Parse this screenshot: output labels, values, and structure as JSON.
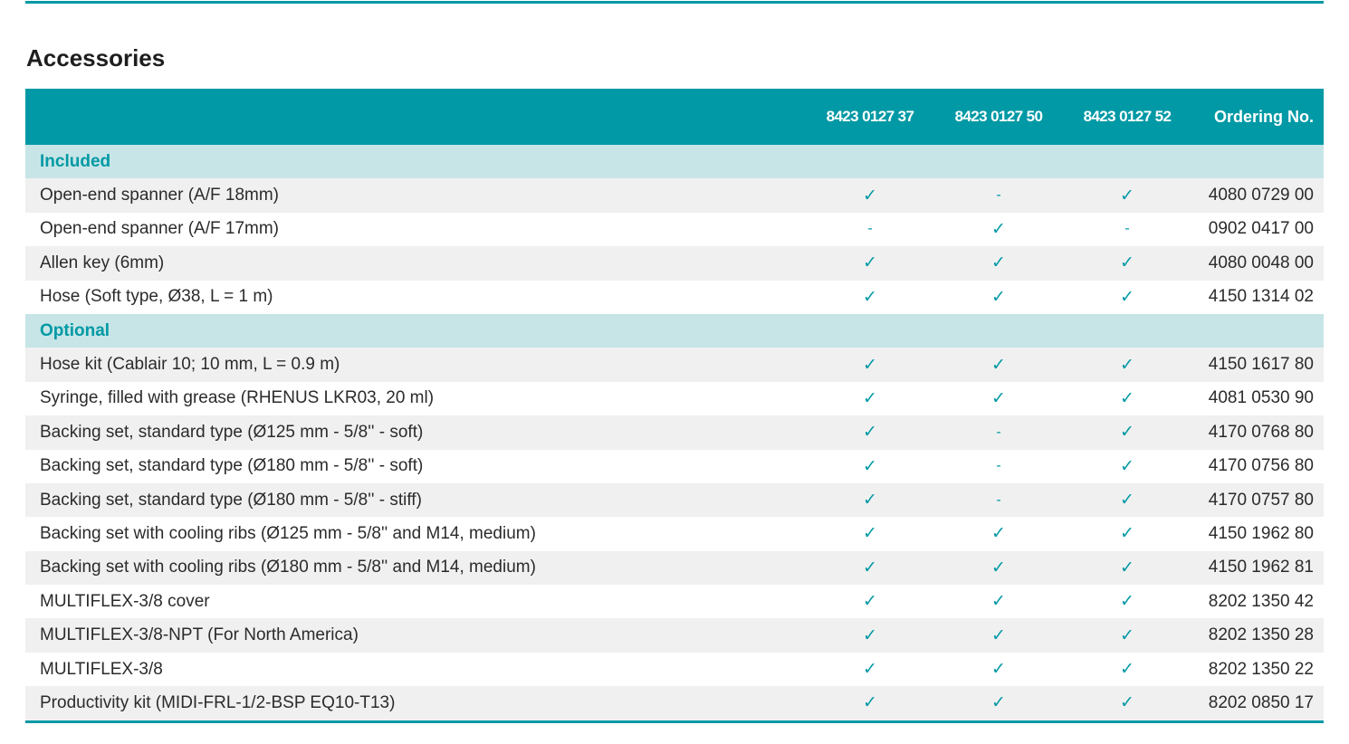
{
  "title": "Accessories",
  "colors": {
    "accent": "#0099a5",
    "group_bg": "#c7e5e6",
    "alt_row": "#f0f0f0"
  },
  "table": {
    "headers": [
      "",
      "8423 0127 37",
      "8423 0127 50",
      "8423 0127 52",
      "Ordering No."
    ],
    "groups": [
      {
        "label": "Included",
        "rows": [
          {
            "desc": "Open-end spanner (A/F 18mm)",
            "marks": [
              "✓",
              "-",
              "✓"
            ],
            "order": "4080 0729 00"
          },
          {
            "desc": "Open-end spanner (A/F 17mm)",
            "marks": [
              "-",
              "✓",
              "-"
            ],
            "order": "0902 0417 00"
          },
          {
            "desc": "Allen key (6mm)",
            "marks": [
              "✓",
              "✓",
              "✓"
            ],
            "order": "4080 0048 00"
          },
          {
            "desc": "Hose (Soft type, Ø38, L = 1 m)",
            "marks": [
              "✓",
              "✓",
              "✓"
            ],
            "order": "4150 1314 02"
          }
        ]
      },
      {
        "label": "Optional",
        "rows": [
          {
            "desc": "Hose kit (Cablair 10; 10 mm, L = 0.9 m)",
            "marks": [
              "✓",
              "✓",
              "✓"
            ],
            "order": "4150 1617 80"
          },
          {
            "desc": "Syringe, filled with grease (RHENUS LKR03, 20 ml)",
            "marks": [
              "✓",
              "✓",
              "✓"
            ],
            "order": "4081 0530 90"
          },
          {
            "desc": "Backing set, standard type (Ø125 mm - 5/8'' - soft)",
            "marks": [
              "✓",
              "-",
              "✓"
            ],
            "order": "4170 0768 80"
          },
          {
            "desc": "Backing set, standard type (Ø180 mm - 5/8'' - soft)",
            "marks": [
              "✓",
              "-",
              "✓"
            ],
            "order": "4170 0756 80"
          },
          {
            "desc": "Backing set, standard type (Ø180 mm - 5/8'' - stiff)",
            "marks": [
              "✓",
              "-",
              "✓"
            ],
            "order": "4170 0757 80"
          },
          {
            "desc": "Backing set with cooling ribs (Ø125 mm - 5/8'' and M14, medium)",
            "marks": [
              "✓",
              "✓",
              "✓"
            ],
            "order": "4150 1962 80"
          },
          {
            "desc": "Backing set with cooling ribs (Ø180 mm - 5/8'' and M14, medium)",
            "marks": [
              "✓",
              "✓",
              "✓"
            ],
            "order": "4150 1962 81"
          },
          {
            "desc": "MULTIFLEX-3/8 cover",
            "marks": [
              "✓",
              "✓",
              "✓"
            ],
            "order": "8202 1350 42"
          },
          {
            "desc": "MULTIFLEX-3/8-NPT (For North America)",
            "marks": [
              "✓",
              "✓",
              "✓"
            ],
            "order": "8202 1350 28"
          },
          {
            "desc": "MULTIFLEX-3/8",
            "marks": [
              "✓",
              "✓",
              "✓"
            ],
            "order": "8202 1350 22"
          },
          {
            "desc": "Productivity kit (MIDI-FRL-1/2-BSP EQ10-T13)",
            "marks": [
              "✓",
              "✓",
              "✓"
            ],
            "order": "8202 0850 17"
          }
        ]
      }
    ]
  }
}
